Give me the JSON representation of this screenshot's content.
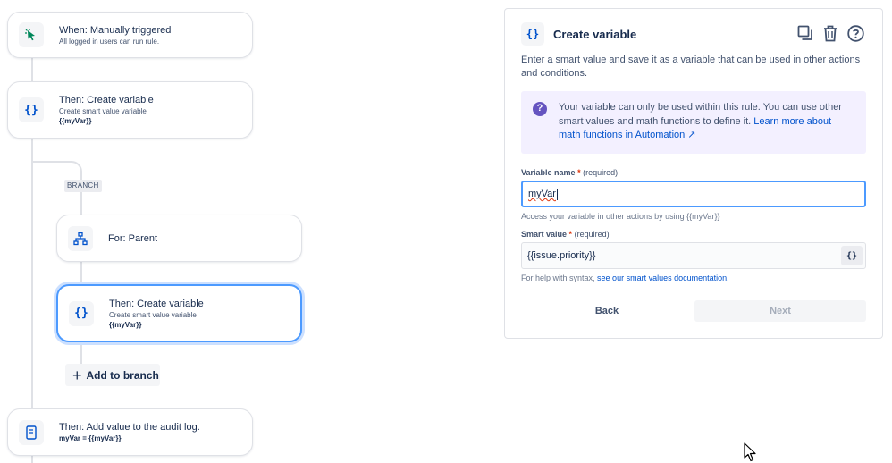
{
  "flow": {
    "trigger": {
      "icon": "cursor-click-icon",
      "title": "When: Manually triggered",
      "subtitle": "All logged in users can run rule."
    },
    "create_var_1": {
      "icon": "curly-braces-icon",
      "icon_glyph": "{}",
      "title": "Then: Create variable",
      "subtitle": "Create smart value variable",
      "var": "{{myVar}}"
    },
    "branch_label": "BRANCH",
    "for_parent": {
      "icon": "hierarchy-icon",
      "title": "For: Parent"
    },
    "create_var_2": {
      "icon": "curly-braces-icon",
      "icon_glyph": "{}",
      "title": "Then: Create variable",
      "subtitle": "Create smart value variable",
      "var": "{{myVar}}"
    },
    "add_to_branch": {
      "icon": "plus-icon",
      "label": "Add to branch"
    },
    "audit_log": {
      "icon": "document-icon",
      "title": "Then: Add value to the audit log.",
      "subtitle": "myVar = {{myVar}}"
    }
  },
  "panel": {
    "icon_glyph": "{}",
    "title": "Create variable",
    "actions": [
      "duplicate-icon",
      "trash-icon",
      "help-icon"
    ],
    "description": "Enter a smart value and save it as a variable that can be used in other actions and conditions.",
    "info": {
      "icon": "question-icon",
      "text": "Your variable can only be used within this rule. You can use other smart values and math functions to define it. ",
      "link": "Learn more about math functions in Automation ↗"
    },
    "variable_name": {
      "label": "Variable name",
      "star": "*",
      "required": "(required)",
      "value": "myVar",
      "help": "Access your variable in other actions by using {{myVar}}"
    },
    "smart_value": {
      "label": "Smart value",
      "star": "*",
      "required": "(required)",
      "value": "{{issue.priority}}",
      "button_glyph": "{}",
      "help_prefix": "For help with syntax, ",
      "help_link": "see our smart values documentation."
    },
    "back_label": "Back",
    "next_label": "Next"
  },
  "colors": {
    "accent": "#0052cc",
    "focus": "#4c9aff",
    "info_bg": "#f3f0ff",
    "info_icon": "#6554c0"
  }
}
